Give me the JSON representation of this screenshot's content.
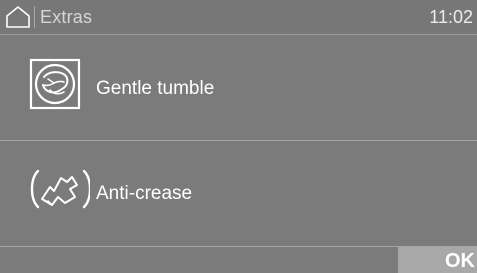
{
  "header": {
    "home_icon": "home-icon",
    "title": "Extras",
    "clock": "11:02"
  },
  "menu": {
    "items": [
      {
        "label": "Gentle tumble",
        "icon": "gentle-tumble-icon"
      },
      {
        "label": "Anti-crease",
        "icon": "anti-crease-icon"
      }
    ]
  },
  "footer": {
    "ok_label": "OK"
  },
  "colors": {
    "background": "#7b7b7b",
    "ok_button": "#a8a8a8",
    "divider": "#a6a6a6",
    "text": "#ffffff"
  }
}
